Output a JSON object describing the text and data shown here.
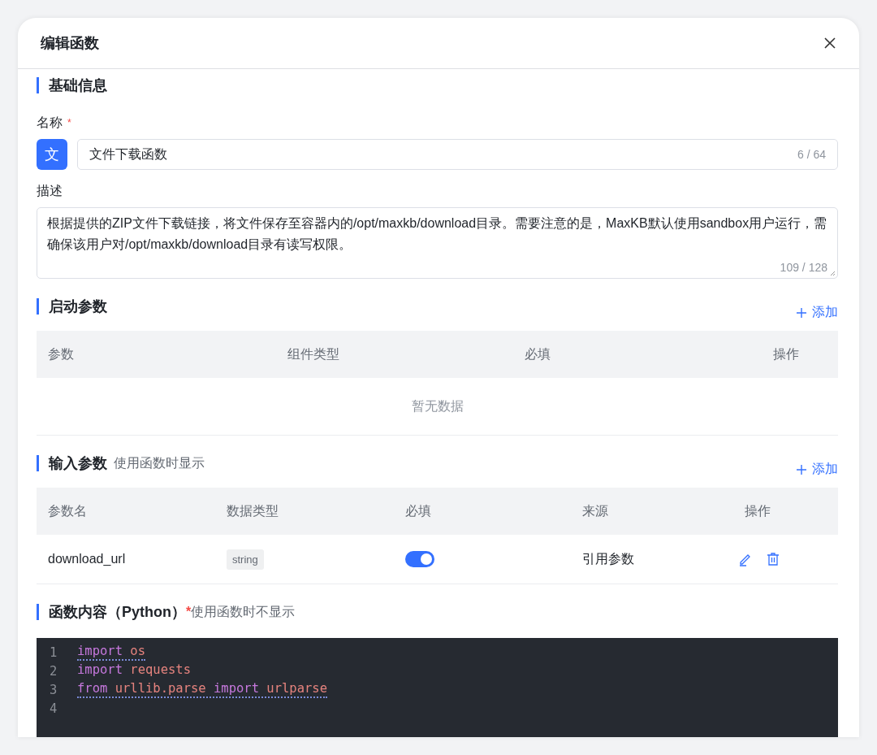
{
  "dialog": {
    "title": "编辑函数"
  },
  "basic_info": {
    "title": "基础信息",
    "name_field": {
      "label": "名称",
      "required_mark": "*",
      "avatar": "文",
      "value": "文件下载函数",
      "count": "6 / 64"
    },
    "description_field": {
      "label": "描述",
      "value": "根据提供的ZIP文件下载链接，将文件保存至容器内的/opt/maxkb/download目录。需要注意的是，MaxKB默认使用sandbox用户运行，需确保该用户对/opt/maxkb/download目录有读写权限。",
      "count": "109 / 128"
    }
  },
  "startup_params": {
    "title": "启动参数",
    "add_label": "添加",
    "columns": [
      "参数",
      "组件类型",
      "必填",
      "操作"
    ],
    "empty_text": "暂无数据"
  },
  "input_params": {
    "title": "输入参数",
    "hint": "使用函数时显示",
    "add_label": "添加",
    "columns": [
      "参数名",
      "数据类型",
      "必填",
      "来源",
      "操作"
    ],
    "rows": [
      {
        "name": "download_url",
        "type": "string",
        "required": true,
        "source": "引用参数"
      }
    ]
  },
  "function_content": {
    "title": "函数内容（Python）",
    "required_mark": "*",
    "hint": "使用函数时不显示",
    "lines": [
      {
        "number": "1",
        "squiggle": true,
        "tokens": [
          {
            "kind": "keyword",
            "text": "import"
          },
          {
            "kind": "name",
            "text": "os"
          }
        ]
      },
      {
        "number": "2",
        "squiggle": false,
        "tokens": [
          {
            "kind": "keyword",
            "text": "import"
          },
          {
            "kind": "name",
            "text": "requests"
          }
        ]
      },
      {
        "number": "3",
        "squiggle": true,
        "tokens": [
          {
            "kind": "keyword",
            "text": "from"
          },
          {
            "kind": "name",
            "text": "urllib.parse"
          },
          {
            "kind": "keyword",
            "text": "import"
          },
          {
            "kind": "name",
            "text": "urlparse"
          }
        ]
      },
      {
        "number": "4"
      }
    ]
  }
}
